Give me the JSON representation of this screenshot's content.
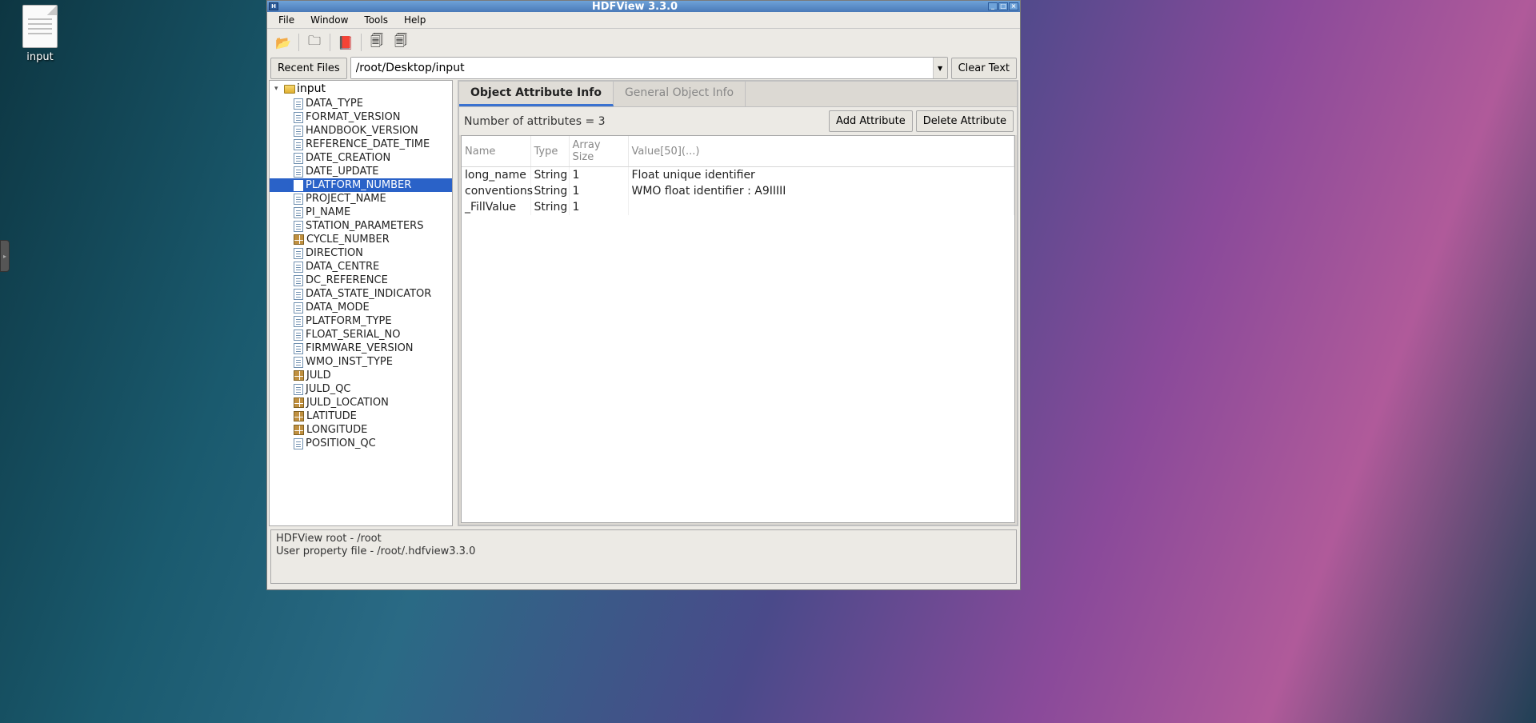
{
  "desktop": {
    "icon_label": "input"
  },
  "window": {
    "title": "HDFView 3.3.0",
    "menu": [
      "File",
      "Window",
      "Tools",
      "Help"
    ],
    "toolbar_icons": [
      "open-icon",
      "folder-icon",
      "book-icon",
      "nav-back-icon",
      "nav-fwd-icon"
    ],
    "recent_label": "Recent Files",
    "path_value": "/root/Desktop/input",
    "clear_label": "Clear Text"
  },
  "tree": {
    "root": "input",
    "items": [
      {
        "label": "DATA_TYPE",
        "icon": "doc"
      },
      {
        "label": "FORMAT_VERSION",
        "icon": "doc"
      },
      {
        "label": "HANDBOOK_VERSION",
        "icon": "doc"
      },
      {
        "label": "REFERENCE_DATE_TIME",
        "icon": "doc"
      },
      {
        "label": "DATE_CREATION",
        "icon": "doc"
      },
      {
        "label": "DATE_UPDATE",
        "icon": "doc"
      },
      {
        "label": "PLATFORM_NUMBER",
        "icon": "doc",
        "selected": true
      },
      {
        "label": "PROJECT_NAME",
        "icon": "doc"
      },
      {
        "label": "PI_NAME",
        "icon": "doc"
      },
      {
        "label": "STATION_PARAMETERS",
        "icon": "doc"
      },
      {
        "label": "CYCLE_NUMBER",
        "icon": "grid"
      },
      {
        "label": "DIRECTION",
        "icon": "doc"
      },
      {
        "label": "DATA_CENTRE",
        "icon": "doc"
      },
      {
        "label": "DC_REFERENCE",
        "icon": "doc"
      },
      {
        "label": "DATA_STATE_INDICATOR",
        "icon": "doc"
      },
      {
        "label": "DATA_MODE",
        "icon": "doc"
      },
      {
        "label": "PLATFORM_TYPE",
        "icon": "doc"
      },
      {
        "label": "FLOAT_SERIAL_NO",
        "icon": "doc"
      },
      {
        "label": "FIRMWARE_VERSION",
        "icon": "doc"
      },
      {
        "label": "WMO_INST_TYPE",
        "icon": "doc"
      },
      {
        "label": "JULD",
        "icon": "grid"
      },
      {
        "label": "JULD_QC",
        "icon": "doc"
      },
      {
        "label": "JULD_LOCATION",
        "icon": "grid"
      },
      {
        "label": "LATITUDE",
        "icon": "grid"
      },
      {
        "label": "LONGITUDE",
        "icon": "grid"
      },
      {
        "label": "POSITION_QC",
        "icon": "doc"
      }
    ]
  },
  "tabs": {
    "active": "Object Attribute Info",
    "inactive": "General Object Info"
  },
  "attributes": {
    "count_text": "Number of attributes = 3",
    "add_label": "Add Attribute",
    "delete_label": "Delete Attribute",
    "columns": [
      "Name",
      "Type",
      "Array Size",
      "Value[50](...)"
    ],
    "rows": [
      {
        "name": "long_name",
        "type": "String",
        "size": "1",
        "value": "Float unique identifier"
      },
      {
        "name": "conventions",
        "type": "String",
        "size": "1",
        "value": "WMO float identifier : A9IIIII"
      },
      {
        "name": "_FillValue",
        "type": "String",
        "size": "1",
        "value": ""
      }
    ]
  },
  "status": {
    "line1": "HDFView root - /root",
    "line2": "User property file - /root/.hdfview3.3.0"
  }
}
